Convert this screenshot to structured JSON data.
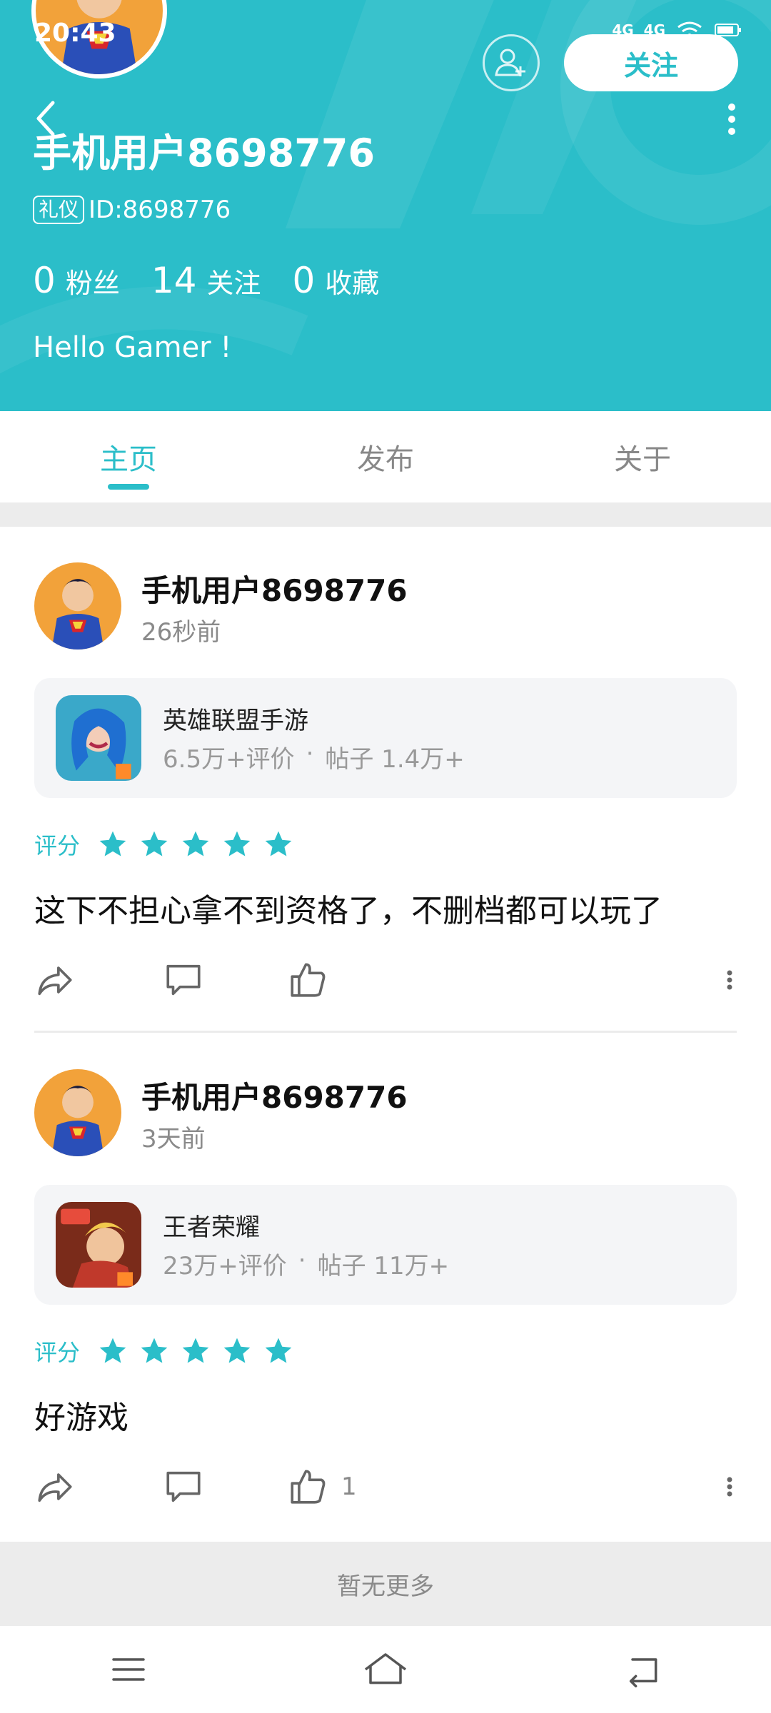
{
  "status_bar": {
    "time": "20:43",
    "network": "4G"
  },
  "profile": {
    "username": "手机用户8698776",
    "badge": "礼仪",
    "id_label": "ID:8698776",
    "bio": "Hello Gamer !",
    "follow_label": "关注",
    "stats": [
      {
        "num": "0",
        "label": "粉丝"
      },
      {
        "num": "14",
        "label": "关注"
      },
      {
        "num": "0",
        "label": "收藏"
      }
    ]
  },
  "tabs": [
    {
      "label": "主页",
      "active": true
    },
    {
      "label": "发布",
      "active": false
    },
    {
      "label": "关于",
      "active": false
    }
  ],
  "posts": [
    {
      "author": "手机用户8698776",
      "time": "26秒前",
      "game": {
        "name": "英雄联盟手游",
        "reviews": "6.5万+评价",
        "dot": "·",
        "posts": "帖子 1.4万+"
      },
      "rating_label": "评分",
      "rating": 5,
      "text": "这下不担心拿不到资格了，不删档都可以玩了",
      "likes": ""
    },
    {
      "author": "手机用户8698776",
      "time": "3天前",
      "game": {
        "name": "王者荣耀",
        "reviews": "23万+评价",
        "dot": "·",
        "posts": "帖子 11万+"
      },
      "rating_label": "评分",
      "rating": 5,
      "text": "好游戏",
      "likes": "1"
    }
  ],
  "footer": {
    "no_more": "暂无更多"
  },
  "colors": {
    "accent": "#2bbec9",
    "star": "#2bbec9",
    "background_gray": "#ececec"
  }
}
